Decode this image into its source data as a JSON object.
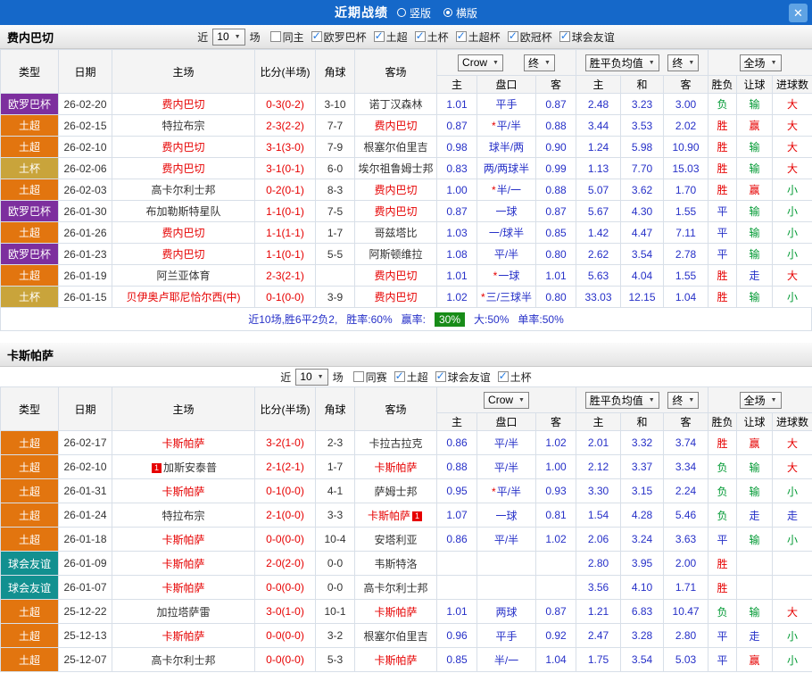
{
  "topbar": {
    "title": "近期战绩",
    "radios": [
      {
        "label": "竖版",
        "selected": false
      },
      {
        "label": "横版",
        "selected": true
      }
    ],
    "close": "✕"
  },
  "league_colors": {
    "欧罗巴杯": "#7d2f9e",
    "土超": "#e2750f",
    "土杯": "#c9a43b",
    "球会友谊": "#129090"
  },
  "result_colors": {
    "r": "#e60000",
    "b": "#2630c8",
    "g": "#009933"
  },
  "s1": {
    "team": "费内巴切",
    "filter": {
      "prefix": "近",
      "games": "10",
      "suffix": "场",
      "checkboxes": [
        {
          "label": "同主",
          "checked": false
        },
        {
          "label": "欧罗巴杯",
          "checked": true
        },
        {
          "label": "土超",
          "checked": true
        },
        {
          "label": "土杯",
          "checked": true
        },
        {
          "label": "土超杯",
          "checked": true
        },
        {
          "label": "欧冠杯",
          "checked": true
        },
        {
          "label": "球会友谊",
          "checked": true
        }
      ]
    },
    "header": {
      "type": "类型",
      "date": "日期",
      "home": "主场",
      "score": "比分(半场)",
      "corner": "角球",
      "away": "客场",
      "odds_select": "Crow",
      "fin_select": "终",
      "avg_select": "胜平负均值",
      "fin2_select": "终",
      "full_select": "全场",
      "sub": [
        "主",
        "盘口",
        "客",
        "主",
        "和",
        "客",
        "胜负",
        "让球",
        "进球数"
      ]
    },
    "rows": [
      {
        "lg": "欧罗巴杯",
        "date": "26-02-20",
        "home": "费内巴切",
        "home_hl": true,
        "away": "诺丁汉森林",
        "score": "0-3(0-2)",
        "corner": "3-10",
        "o1": "1.01",
        "star": false,
        "hcp": "平手",
        "o2": "0.87",
        "m1": "2.48",
        "m2": "3.23",
        "m3": "3.00",
        "res": [
          [
            "负",
            "g"
          ],
          [
            "输",
            "g"
          ],
          [
            "大",
            "r"
          ]
        ]
      },
      {
        "lg": "土超",
        "date": "26-02-15",
        "home": "特拉布宗",
        "away": "费内巴切",
        "away_hl": true,
        "score": "2-3(2-2)",
        "corner": "7-7",
        "o1": "0.87",
        "star": true,
        "hcp": "平/半",
        "o2": "0.88",
        "m1": "3.44",
        "m2": "3.53",
        "m3": "2.02",
        "res": [
          [
            "胜",
            "r"
          ],
          [
            "赢",
            "r"
          ],
          [
            "大",
            "r"
          ]
        ]
      },
      {
        "lg": "土超",
        "date": "26-02-10",
        "home": "费内巴切",
        "home_hl": true,
        "away": "根塞尔伯里吉",
        "score": "3-1(3-0)",
        "corner": "7-9",
        "o1": "0.98",
        "star": false,
        "hcp": "球半/两",
        "o2": "0.90",
        "m1": "1.24",
        "m2": "5.98",
        "m3": "10.90",
        "res": [
          [
            "胜",
            "r"
          ],
          [
            "输",
            "g"
          ],
          [
            "大",
            "r"
          ]
        ]
      },
      {
        "lg": "土杯",
        "date": "26-02-06",
        "home": "费内巴切",
        "home_hl": true,
        "away": "埃尔祖鲁姆士邦",
        "score": "3-1(0-1)",
        "corner": "6-0",
        "o1": "0.83",
        "star": false,
        "hcp": "两/两球半",
        "o2": "0.99",
        "m1": "1.13",
        "m2": "7.70",
        "m3": "15.03",
        "res": [
          [
            "胜",
            "r"
          ],
          [
            "输",
            "g"
          ],
          [
            "大",
            "r"
          ]
        ]
      },
      {
        "lg": "土超",
        "date": "26-02-03",
        "home": "高卡尔利士邦",
        "away": "费内巴切",
        "away_hl": true,
        "score": "0-2(0-1)",
        "corner": "8-3",
        "o1": "1.00",
        "star": true,
        "hcp": "半/一",
        "o2": "0.88",
        "m1": "5.07",
        "m2": "3.62",
        "m3": "1.70",
        "res": [
          [
            "胜",
            "r"
          ],
          [
            "赢",
            "r"
          ],
          [
            "小",
            "g"
          ]
        ]
      },
      {
        "lg": "欧罗巴杯",
        "date": "26-01-30",
        "home": "布加勒斯特星队",
        "away": "费内巴切",
        "away_hl": true,
        "score": "1-1(0-1)",
        "corner": "7-5",
        "o1": "0.87",
        "star": false,
        "hcp": "一球",
        "o2": "0.87",
        "m1": "5.67",
        "m2": "4.30",
        "m3": "1.55",
        "res": [
          [
            "平",
            "b"
          ],
          [
            "输",
            "g"
          ],
          [
            "小",
            "g"
          ]
        ]
      },
      {
        "lg": "土超",
        "date": "26-01-26",
        "home": "费内巴切",
        "home_hl": true,
        "away": "哥兹塔比",
        "score": "1-1(1-1)",
        "corner": "1-7",
        "o1": "1.03",
        "star": false,
        "hcp": "一/球半",
        "o2": "0.85",
        "m1": "1.42",
        "m2": "4.47",
        "m3": "7.11",
        "res": [
          [
            "平",
            "b"
          ],
          [
            "输",
            "g"
          ],
          [
            "小",
            "g"
          ]
        ]
      },
      {
        "lg": "欧罗巴杯",
        "date": "26-01-23",
        "home": "费内巴切",
        "home_hl": true,
        "away": "阿斯顿维拉",
        "score": "1-1(0-1)",
        "corner": "5-5",
        "o1": "1.08",
        "star": false,
        "hcp": "平/半",
        "o2": "0.80",
        "m1": "2.62",
        "m2": "3.54",
        "m3": "2.78",
        "res": [
          [
            "平",
            "b"
          ],
          [
            "输",
            "g"
          ],
          [
            "小",
            "g"
          ]
        ]
      },
      {
        "lg": "土超",
        "date": "26-01-19",
        "home": "阿兰亚体育",
        "away": "费内巴切",
        "away_hl": true,
        "score": "2-3(2-1)",
        "corner": "",
        "o1": "1.01",
        "star": true,
        "hcp": "一球",
        "o2": "1.01",
        "m1": "5.63",
        "m2": "4.04",
        "m3": "1.55",
        "res": [
          [
            "胜",
            "r"
          ],
          [
            "走",
            "b"
          ],
          [
            "大",
            "r"
          ]
        ]
      },
      {
        "lg": "土杯",
        "date": "26-01-15",
        "home": "贝伊奥卢耶尼恰尔西(中)",
        "home_hl": true,
        "away": "费内巴切",
        "away_hl": true,
        "score": "0-1(0-0)",
        "corner": "3-9",
        "o1": "1.02",
        "star": true,
        "hcp": "三/三球半",
        "o2": "0.80",
        "m1": "33.03",
        "m2": "12.15",
        "m3": "1.04",
        "res": [
          [
            "胜",
            "r"
          ],
          [
            "输",
            "g"
          ],
          [
            "小",
            "g"
          ]
        ]
      }
    ],
    "summary": {
      "part1": "近10场,胜6平2负2,",
      "part2": "胜率:60%",
      "part3": "赢率:",
      "badge": "30%",
      "part4": "大:50%",
      "part5": "单率:50%"
    }
  },
  "s2": {
    "team": "卡斯帕萨",
    "filter": {
      "prefix": "近",
      "games": "10",
      "suffix": "场",
      "checkboxes": [
        {
          "label": "同赛",
          "checked": false
        },
        {
          "label": "土超",
          "checked": true
        },
        {
          "label": "球会友谊",
          "checked": true
        },
        {
          "label": "土杯",
          "checked": true
        }
      ]
    },
    "header": {
      "type": "类型",
      "date": "日期",
      "home": "主场",
      "score": "比分(半场)",
      "corner": "角球",
      "away": "客场",
      "odds_select": "Crow",
      "avg_select": "胜平负均值",
      "fin2_select": "终",
      "full_select": "全场",
      "sub": [
        "主",
        "盘口",
        "客",
        "主",
        "和",
        "客",
        "胜负",
        "让球",
        "进球数"
      ]
    },
    "rows": [
      {
        "lg": "土超",
        "date": "26-02-17",
        "home": "卡斯帕萨",
        "home_hl": true,
        "away": "卡拉古拉克",
        "score": "3-2(1-0)",
        "corner": "2-3",
        "o1": "0.86",
        "star": false,
        "hcp": "平/半",
        "o2": "1.02",
        "m1": "2.01",
        "m2": "3.32",
        "m3": "3.74",
        "res": [
          [
            "胜",
            "r"
          ],
          [
            "赢",
            "r"
          ],
          [
            "大",
            "r"
          ]
        ]
      },
      {
        "lg": "土超",
        "date": "26-02-10",
        "home": "加斯安泰普",
        "home_card": "1",
        "home_card_pos": "l",
        "away": "卡斯帕萨",
        "away_hl": true,
        "score": "2-1(2-1)",
        "corner": "1-7",
        "o1": "0.88",
        "star": false,
        "hcp": "平/半",
        "o2": "1.00",
        "m1": "2.12",
        "m2": "3.37",
        "m3": "3.34",
        "res": [
          [
            "负",
            "g"
          ],
          [
            "输",
            "g"
          ],
          [
            "大",
            "r"
          ]
        ]
      },
      {
        "lg": "土超",
        "date": "26-01-31",
        "home": "卡斯帕萨",
        "home_hl": true,
        "away": "萨姆士邦",
        "score": "0-1(0-0)",
        "corner": "4-1",
        "o1": "0.95",
        "star": true,
        "hcp": "平/半",
        "o2": "0.93",
        "m1": "3.30",
        "m2": "3.15",
        "m3": "2.24",
        "res": [
          [
            "负",
            "g"
          ],
          [
            "输",
            "g"
          ],
          [
            "小",
            "g"
          ]
        ]
      },
      {
        "lg": "土超",
        "date": "26-01-24",
        "home": "特拉布宗",
        "away": "卡斯帕萨",
        "away_hl": true,
        "away_card": "1",
        "away_card_pos": "r",
        "score": "2-1(0-0)",
        "corner": "3-3",
        "o1": "1.07",
        "star": false,
        "hcp": "一球",
        "o2": "0.81",
        "m1": "1.54",
        "m2": "4.28",
        "m3": "5.46",
        "res": [
          [
            "负",
            "g"
          ],
          [
            "走",
            "b"
          ],
          [
            "走",
            "b"
          ]
        ]
      },
      {
        "lg": "土超",
        "date": "26-01-18",
        "home": "卡斯帕萨",
        "home_hl": true,
        "away": "安塔利亚",
        "score": "0-0(0-0)",
        "corner": "10-4",
        "o1": "0.86",
        "star": false,
        "hcp": "平/半",
        "o2": "1.02",
        "m1": "2.06",
        "m2": "3.24",
        "m3": "3.63",
        "res": [
          [
            "平",
            "b"
          ],
          [
            "输",
            "g"
          ],
          [
            "小",
            "g"
          ]
        ]
      },
      {
        "lg": "球会友谊",
        "date": "26-01-09",
        "home": "卡斯帕萨",
        "home_hl": true,
        "away": "韦斯特洛",
        "score": "2-0(2-0)",
        "corner": "0-0",
        "o1": "",
        "star": false,
        "hcp": "",
        "o2": "",
        "m1": "2.80",
        "m2": "3.95",
        "m3": "2.00",
        "res": [
          [
            "胜",
            "r"
          ],
          [
            "",
            ""
          ],
          [
            "",
            ""
          ]
        ]
      },
      {
        "lg": "球会友谊",
        "date": "26-01-07",
        "home": "卡斯帕萨",
        "home_hl": true,
        "away": "高卡尔利士邦",
        "score": "0-0(0-0)",
        "corner": "0-0",
        "o1": "",
        "star": false,
        "hcp": "",
        "o2": "",
        "m1": "3.56",
        "m2": "4.10",
        "m3": "1.71",
        "res": [
          [
            "胜",
            "r"
          ],
          [
            "",
            ""
          ],
          [
            "",
            ""
          ]
        ]
      },
      {
        "lg": "土超",
        "date": "25-12-22",
        "home": "加拉塔萨雷",
        "away": "卡斯帕萨",
        "away_hl": true,
        "score": "3-0(1-0)",
        "corner": "10-1",
        "o1": "1.01",
        "star": false,
        "hcp": "两球",
        "o2": "0.87",
        "m1": "1.21",
        "m2": "6.83",
        "m3": "10.47",
        "res": [
          [
            "负",
            "g"
          ],
          [
            "输",
            "g"
          ],
          [
            "大",
            "r"
          ]
        ]
      },
      {
        "lg": "土超",
        "date": "25-12-13",
        "home": "卡斯帕萨",
        "home_hl": true,
        "away": "根塞尔伯里吉",
        "score": "0-0(0-0)",
        "corner": "3-2",
        "o1": "0.96",
        "star": false,
        "hcp": "平手",
        "o2": "0.92",
        "m1": "2.47",
        "m2": "3.28",
        "m3": "2.80",
        "res": [
          [
            "平",
            "b"
          ],
          [
            "走",
            "b"
          ],
          [
            "小",
            "g"
          ]
        ]
      },
      {
        "lg": "土超",
        "date": "25-12-07",
        "home": "高卡尔利士邦",
        "away": "卡斯帕萨",
        "away_hl": true,
        "score": "0-0(0-0)",
        "corner": "5-3",
        "o1": "0.85",
        "star": false,
        "hcp": "半/一",
        "o2": "1.04",
        "m1": "1.75",
        "m2": "3.54",
        "m3": "5.03",
        "res": [
          [
            "平",
            "b"
          ],
          [
            "赢",
            "r"
          ],
          [
            "小",
            "g"
          ]
        ]
      }
    ]
  }
}
